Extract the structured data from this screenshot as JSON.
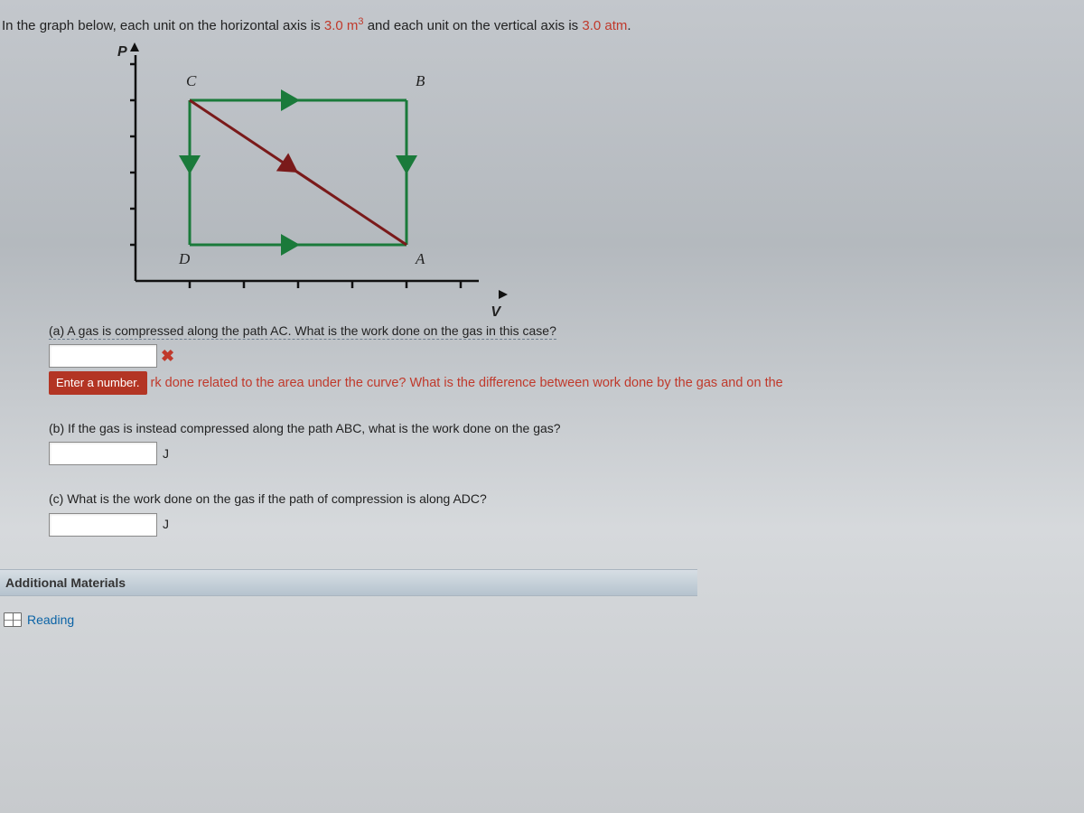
{
  "intro": {
    "lead": "In the graph below, each unit on the horizontal axis is ",
    "h_value": "3.0 m",
    "h_exp": "3",
    "mid": " and each unit on the vertical axis is ",
    "v_value": "3.0 atm",
    "tail": "."
  },
  "graph": {
    "y_label": "P",
    "x_label": "V",
    "corners": {
      "A": "A",
      "B": "B",
      "C": "C",
      "D": "D"
    }
  },
  "chart_data": {
    "type": "line",
    "xlabel": "V",
    "ylabel": "P",
    "x_tick_step": 1,
    "y_tick_step": 1,
    "x_unit_value": 3.0,
    "x_unit_label": "m^3",
    "y_unit_value": 3.0,
    "y_unit_label": "atm",
    "xlim": [
      0,
      6
    ],
    "ylim": [
      0,
      6
    ],
    "series": [
      {
        "name": "side DA (A→D)",
        "color": "#1a7a3a",
        "points": [
          [
            5,
            1
          ],
          [
            1,
            1
          ]
        ]
      },
      {
        "name": "side DC (D→C)",
        "color": "#1a7a3a",
        "points": [
          [
            1,
            1
          ],
          [
            1,
            5
          ]
        ]
      },
      {
        "name": "side CB (B→C)",
        "color": "#1a7a3a",
        "points": [
          [
            5,
            5
          ],
          [
            1,
            5
          ]
        ]
      },
      {
        "name": "side BA (A→B)",
        "color": "#1a7a3a",
        "points": [
          [
            5,
            1
          ],
          [
            5,
            5
          ]
        ]
      },
      {
        "name": "diag AC (A→C)",
        "color": "#7a1a1a",
        "points": [
          [
            5,
            1
          ],
          [
            1,
            5
          ]
        ]
      }
    ],
    "labeled_points": {
      "A": [
        5,
        1
      ],
      "B": [
        5,
        5
      ],
      "C": [
        1,
        5
      ],
      "D": [
        1,
        1
      ]
    }
  },
  "parts": {
    "a": {
      "prompt": "(a) A gas is compressed along the path AC. What is the work done on the gas in this case?",
      "input_value": "",
      "tooltip": "Enter a number.",
      "hint_fragment": "rk done related to the area under the curve? What is the difference between work done by the gas and on the"
    },
    "b": {
      "prompt": "(b) If the gas is instead compressed along the path ABC, what is the work done on the gas?",
      "unit": "J",
      "input_value": ""
    },
    "c": {
      "prompt": "(c) What is the work done on the gas if the path of compression is along ADC?",
      "unit": "J",
      "input_value": ""
    }
  },
  "additional": {
    "title": "Additional Materials",
    "reading_label": "Reading"
  }
}
